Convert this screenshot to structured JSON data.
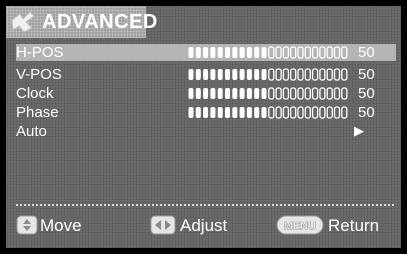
{
  "menu": {
    "title": "ADVANCED",
    "icon": "settings-icon",
    "items": [
      {
        "label": "H-POS",
        "value": "50",
        "level": 0.5,
        "selected": true,
        "type": "slider"
      },
      {
        "label": "V-POS",
        "value": "50",
        "level": 0.5,
        "selected": false,
        "type": "slider"
      },
      {
        "label": "Clock",
        "value": "50",
        "level": 0.5,
        "selected": false,
        "type": "slider"
      },
      {
        "label": "Phase",
        "value": "50",
        "level": 0.5,
        "selected": false,
        "type": "slider"
      },
      {
        "label": "Auto",
        "value": "▶",
        "selected": false,
        "type": "action"
      }
    ]
  },
  "footer": {
    "move_label": "Move",
    "adjust_label": "Adjust",
    "menu_key": "MENU",
    "return_label": "Return"
  },
  "colors": {
    "background": "#6e6e6e",
    "selected_row": "#b5b5b5",
    "bar_filled": "#ffffff",
    "bar_empty": "#ffffff"
  }
}
